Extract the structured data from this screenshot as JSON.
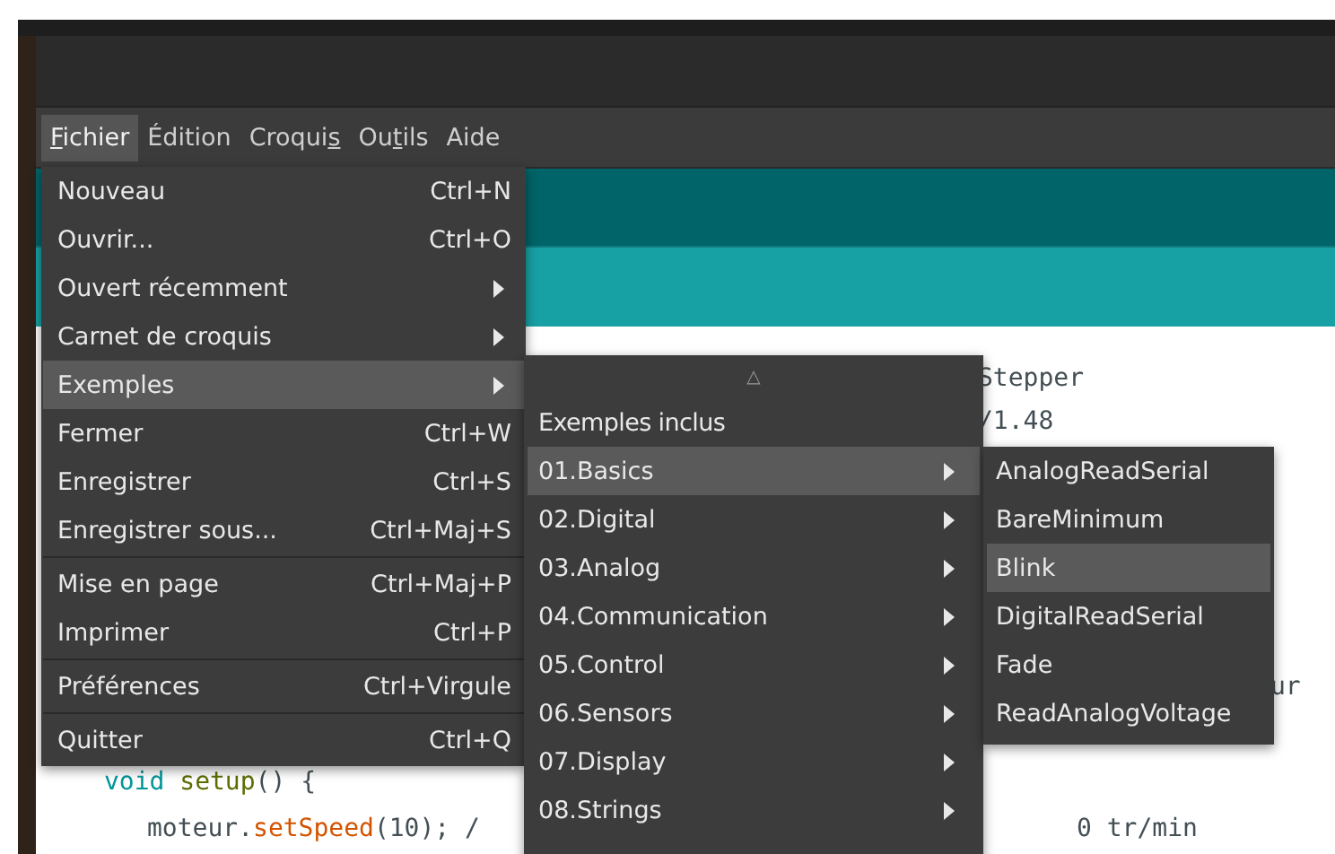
{
  "menubar": [
    {
      "key": "F",
      "after": "ichier",
      "selected": true
    },
    {
      "before": "Édition",
      "selected": false
    },
    {
      "before": "Croqui",
      "key": "s",
      "selected": false
    },
    {
      "before": "Ou",
      "key": "t",
      "after": "ils",
      "selected": false
    },
    {
      "before": "Aide",
      "selected": false
    }
  ],
  "editor": {
    "lines": [
      {
        "tokens": [
          {
            "kind": "plain",
            "text": "Stepper"
          }
        ]
      },
      {
        "tokens": [
          {
            "kind": "plain",
            "text": "/1.48"
          }
        ]
      },
      {
        "tokens": [
          {
            "kind": "plain",
            "text": "ur"
          }
        ]
      },
      {
        "tokens": [
          {
            "kind": "keyword",
            "text": "void"
          },
          {
            "kind": "function_name",
            "text": "setup",
            "space_before": true
          },
          {
            "kind": "plain",
            "text": "() {"
          }
        ]
      },
      {
        "tokens": [
          {
            "kind": "plain",
            "text": "moteur."
          },
          {
            "kind": "method",
            "text": "setSpeed"
          },
          {
            "kind": "plain",
            "text": "(10); /"
          }
        ]
      },
      {
        "tokens": [
          {
            "kind": "plain",
            "text": "0 tr/min"
          }
        ]
      }
    ]
  },
  "file_menu": {
    "items": [
      {
        "label": "Nouveau",
        "shortcut": "Ctrl+N",
        "submenu": false,
        "selected": false,
        "separator_before": false
      },
      {
        "label": "Ouvrir...",
        "shortcut": "Ctrl+O",
        "submenu": false,
        "selected": false,
        "separator_before": false
      },
      {
        "label": "Ouvert récemment",
        "submenu": true,
        "selected": false,
        "separator_before": false
      },
      {
        "label": "Carnet de croquis",
        "submenu": true,
        "selected": false,
        "separator_before": false
      },
      {
        "label": "Exemples",
        "submenu": true,
        "selected": true,
        "separator_before": false
      },
      {
        "label": "Fermer",
        "shortcut": "Ctrl+W",
        "submenu": false,
        "selected": false,
        "separator_before": false
      },
      {
        "label": "Enregistrer",
        "shortcut": "Ctrl+S",
        "submenu": false,
        "selected": false,
        "separator_before": false
      },
      {
        "label": "Enregistrer sous...",
        "shortcut": "Ctrl+Maj+S",
        "submenu": false,
        "selected": false,
        "separator_before": false
      },
      {
        "label": "Mise en page",
        "shortcut": "Ctrl+Maj+P",
        "submenu": false,
        "selected": false,
        "separator_before": true
      },
      {
        "label": "Imprimer",
        "shortcut": "Ctrl+P",
        "submenu": false,
        "selected": false,
        "separator_before": false
      },
      {
        "label": "Préférences",
        "shortcut": "Ctrl+Virgule",
        "submenu": false,
        "selected": false,
        "separator_before": true
      },
      {
        "label": "Quitter",
        "shortcut": "Ctrl+Q",
        "submenu": false,
        "selected": false,
        "separator_before": true
      }
    ]
  },
  "examples_menu": {
    "scroll_up": "△",
    "header": "Exemples inclus",
    "items": [
      {
        "label": "01.Basics",
        "selected": true
      },
      {
        "label": "02.Digital",
        "selected": false
      },
      {
        "label": "03.Analog",
        "selected": false
      },
      {
        "label": "04.Communication",
        "selected": false
      },
      {
        "label": "05.Control",
        "selected": false
      },
      {
        "label": "06.Sensors",
        "selected": false
      },
      {
        "label": "07.Display",
        "selected": false
      },
      {
        "label": "08.Strings",
        "selected": false
      }
    ]
  },
  "basics_menu": {
    "items": [
      {
        "label": "AnalogReadSerial",
        "selected": false
      },
      {
        "label": "BareMinimum",
        "selected": false
      },
      {
        "label": "Blink",
        "selected": true
      },
      {
        "label": "DigitalReadSerial",
        "selected": false
      },
      {
        "label": "Fade",
        "selected": false
      },
      {
        "label": "ReadAnalogVoltage",
        "selected": false
      }
    ]
  }
}
